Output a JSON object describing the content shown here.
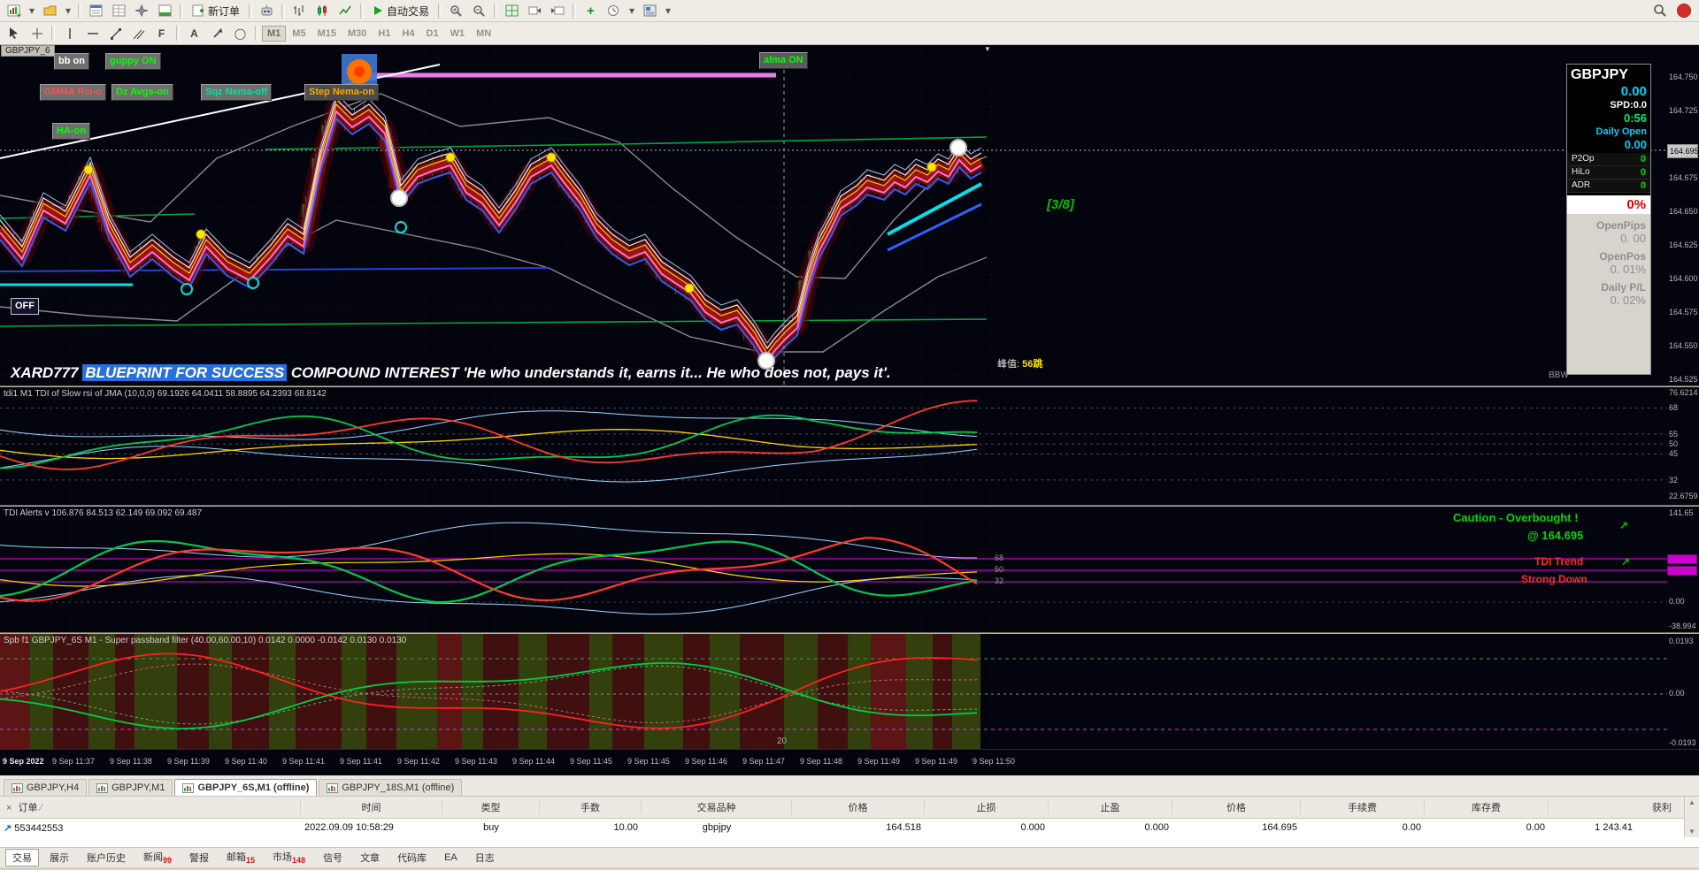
{
  "toolbar": {
    "new_order_label": "新订单",
    "autotrade_label": "自动交易"
  },
  "timeframes": [
    "M1",
    "M5",
    "M15",
    "M30",
    "H1",
    "H4",
    "D1",
    "W1",
    "MN"
  ],
  "icons": {
    "dropdown": "▾",
    "text_tool": "A",
    "fibo": "F",
    "shapes": "◯",
    "buy_arrow": "↗",
    "close": "×",
    "sort": "∕",
    "scroll_up": "▲",
    "scroll_down": "▼",
    "end_marker": "▼",
    "caution_arrow": "↗"
  },
  "chart": {
    "title_tag": "GBPJPY_6",
    "buttons": {
      "bb": "bb on",
      "guppy": "guppy ON",
      "gmma": "GMMA Rsi-o",
      "dz": "Dz Avgs-on",
      "sqz": "Sqz Nema-off",
      "step": "Step Nema-on",
      "ha": "HA-on",
      "alma": "alma ON",
      "off": "OFF"
    },
    "annotation": "[3/8]",
    "peak_label": "峰值:",
    "peak_value": "56跳",
    "quote_name": "XARD777",
    "quote_highlight": "BLUEPRINT FOR SUCCESS",
    "quote_rest": "COMPOUND INTEREST  'He who understands it, earns it... He who does not, pays it'.",
    "bbw_label": "BBW",
    "price_axis": [
      "164.750",
      "164.725",
      "164.675",
      "164.650",
      "164.625",
      "164.600",
      "164.575",
      "164.550",
      "164.525"
    ],
    "current_price": "164.695",
    "scroll_marker": "20"
  },
  "dashboard": {
    "symbol": "GBPJPY",
    "value1": "0.00",
    "spd": "SPD:0.0",
    "timer": "0:56",
    "daily_open_label": "Daily Open",
    "daily_open_value": "0.00",
    "rows": [
      {
        "label": "P2Op",
        "value": "0"
      },
      {
        "label": "HiLo",
        "value": "0"
      },
      {
        "label": "ADR",
        "value": "0"
      }
    ],
    "pct": "0%",
    "open_pips_label": "OpenPips",
    "open_pips_value": "0. 00",
    "open_pos_label": "OpenPos",
    "open_pos_value": "0. 01%",
    "daily_pl_label": "Daily P/L",
    "daily_pl_value": "0. 02%"
  },
  "panels": {
    "tdi1": {
      "title": "tdi1 M1 TDI of Slow rsi of JMA (10,0,0) 69.1926 64.0411 58.8895 64.2393 68.8142",
      "axis": [
        "76.6214",
        "68",
        "55",
        "50",
        "45",
        "32",
        "22.6759"
      ]
    },
    "tdi_alerts": {
      "title": "TDI Alerts v 106.876 84.513 62.149 69.092 69.487",
      "caution": "Caution - Overbought !",
      "at_price": "@ 164.695",
      "trend_label": "TDI Trend",
      "trend_state": "Strong Down",
      "levels": [
        "68",
        "50",
        "32"
      ],
      "axis": [
        "141.65",
        "0.00",
        "-38.994"
      ]
    },
    "spb": {
      "title": "Spb f1 GBPJPY_6S M1 - Super passband filter (40.00,60.00,10) 0.0142 0.0000 -0.0142 0.0130 0.0130",
      "axis": [
        "0.0193",
        "0.00",
        "-0.0193"
      ]
    }
  },
  "time_axis": [
    "9 Sep 2022",
    "9 Sep 11:37",
    "9 Sep 11:38",
    "9 Sep 11:39",
    "9 Sep 11:40",
    "9 Sep 11:41",
    "9 Sep 11:41",
    "9 Sep 11:42",
    "9 Sep 11:43",
    "9 Sep 11:44",
    "9 Sep 11:45",
    "9 Sep 11:45",
    "9 Sep 11:46",
    "9 Sep 11:47",
    "9 Sep 11:48",
    "9 Sep 11:49",
    "9 Sep 11:49",
    "9 Sep 11:50"
  ],
  "chart_tabs": [
    {
      "label": "GBPJPY,H4",
      "active": false
    },
    {
      "label": "GBPJPY,M1",
      "active": false
    },
    {
      "label": "GBPJPY_6S,M1 (offline)",
      "active": true
    },
    {
      "label": "GBPJPY_18S,M1 (offline)",
      "active": false
    }
  ],
  "terminal": {
    "order_header": "订单",
    "columns": [
      "时间",
      "类型",
      "手数",
      "交易品种",
      "价格",
      "止损",
      "止盈",
      "价格",
      "手续费",
      "库存费",
      "获利"
    ],
    "rows": [
      {
        "id": "553442553",
        "time": "2022.09.09 10:58:29",
        "type": "buy",
        "lots": "10.00",
        "symbol": "gbpjpy",
        "price": "164.518",
        "sl": "0.000",
        "tp": "0.000",
        "price2": "164.695",
        "commission": "0.00",
        "swap": "0.00",
        "profit": "1 243.41"
      }
    ],
    "tabs": [
      {
        "label": "交易",
        "badge": "",
        "active": true
      },
      {
        "label": "展示",
        "badge": "",
        "active": false
      },
      {
        "label": "账户历史",
        "badge": "",
        "active": false
      },
      {
        "label": "新闻",
        "badge": "99",
        "active": false
      },
      {
        "label": "警报",
        "badge": "",
        "active": false
      },
      {
        "label": "邮箱",
        "badge": "15",
        "active": false
      },
      {
        "label": "市场",
        "badge": "148",
        "active": false
      },
      {
        "label": "信号",
        "badge": "",
        "active": false
      },
      {
        "label": "文章",
        "badge": "",
        "active": false
      },
      {
        "label": "代码库",
        "badge": "",
        "active": false
      },
      {
        "label": "EA",
        "badge": "",
        "active": false
      },
      {
        "label": "日志",
        "badge": "",
        "active": false
      }
    ]
  },
  "colors": {
    "chart_bg": "#04040e",
    "up_green": "#12a342",
    "down_red": "#6e0f0f",
    "magenta_level": "#cc00cc",
    "caution_green": "#00d600",
    "alert_red": "#ff2a2a",
    "cyan_accent": "#00cfff",
    "magenta_band": "#ee7bee"
  }
}
